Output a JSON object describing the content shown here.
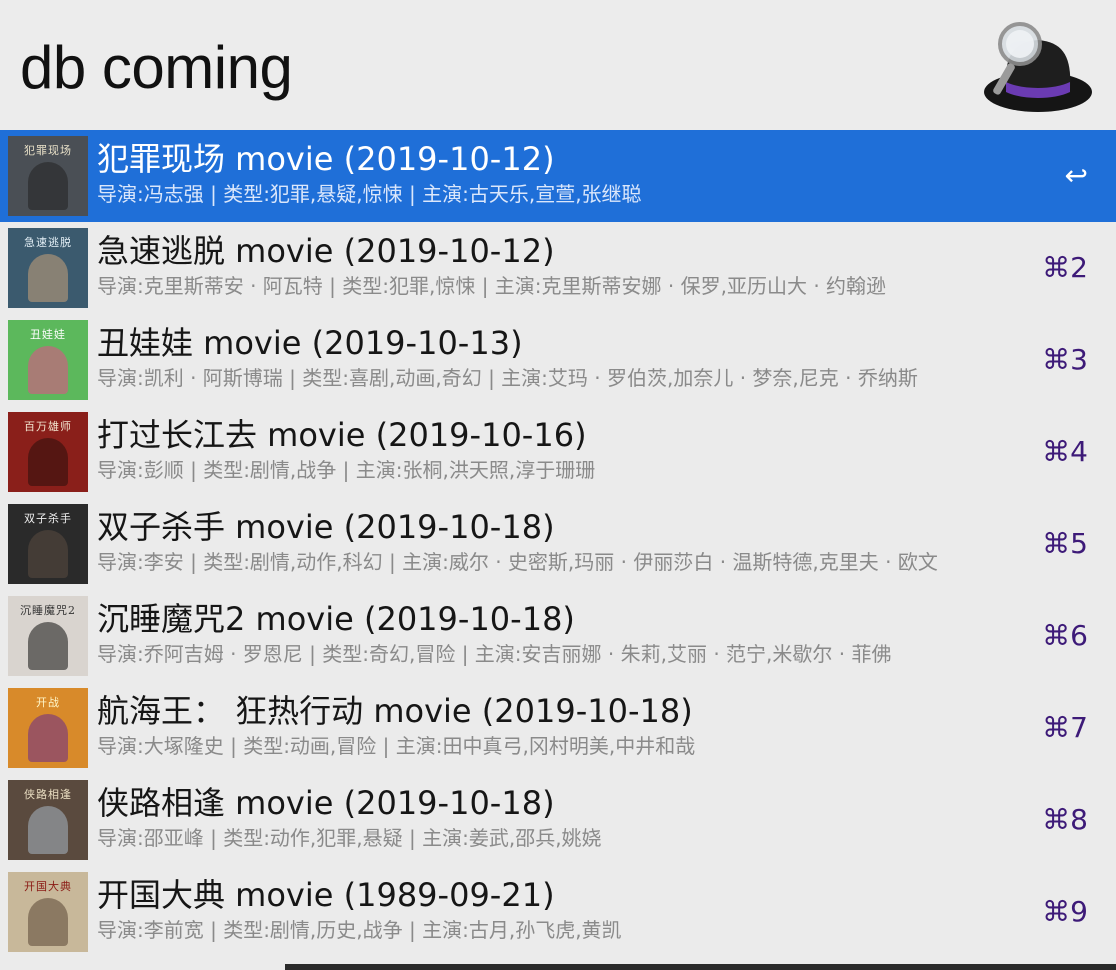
{
  "query": {
    "value": "db coming"
  },
  "results": [
    {
      "title": "犯罪现场 movie (2019-10-12)",
      "subtitle": "导演:冯志强 | 类型:犯罪,悬疑,惊悚 | 主演:古天乐,宣萱,张继聪",
      "shortcut": "↩",
      "selected": true,
      "poster": {
        "text": "犯罪现场",
        "bg": "#4a4f55",
        "fg": "#e8e0c8",
        "fig": "#222"
      }
    },
    {
      "title": "急速逃脱 movie (2019-10-12)",
      "subtitle": "导演:克里斯蒂安 · 阿瓦特 | 类型:犯罪,惊悚 | 主演:克里斯蒂安娜 · 保罗,亚历山大 · 约翰逊",
      "shortcut": "⌘2",
      "selected": false,
      "poster": {
        "text": "急速逃脱",
        "bg": "#3b5a6e",
        "fg": "#e2eef5",
        "fig": "#c9a27a"
      }
    },
    {
      "title": "丑娃娃 movie (2019-10-13)",
      "subtitle": "导演:凯利 · 阿斯博瑞 | 类型:喜剧,动画,奇幻 | 主演:艾玛 · 罗伯茨,加奈儿 · 梦奈,尼克 · 乔纳斯",
      "shortcut": "⌘3",
      "selected": false,
      "poster": {
        "text": "丑娃娃",
        "bg": "#5cb85c",
        "fg": "#ffffff",
        "fig": "#e84a8a"
      }
    },
    {
      "title": "打过长江去 movie (2019-10-16)",
      "subtitle": "导演:彭顺 | 类型:剧情,战争 | 主演:张桐,洪天照,淳于珊珊",
      "shortcut": "⌘4",
      "selected": false,
      "poster": {
        "text": "百万雄师",
        "bg": "#8a1f1a",
        "fg": "#f3e6d0",
        "fig": "#2a0e0c"
      }
    },
    {
      "title": "双子杀手 movie (2019-10-18)",
      "subtitle": "导演:李安 | 类型:剧情,动作,科幻 | 主演:威尔 · 史密斯,玛丽 · 伊丽莎白 · 温斯特德,克里夫 · 欧文",
      "shortcut": "⌘5",
      "selected": false,
      "poster": {
        "text": "双子杀手",
        "bg": "#2a2a2a",
        "fg": "#eeeeee",
        "fig": "#5a4a40"
      }
    },
    {
      "title": "沉睡魔咒2 movie (2019-10-18)",
      "subtitle": "导演:乔阿吉姆 · 罗恩尼 | 类型:奇幻,冒险 | 主演:安吉丽娜 · 朱莉,艾丽 · 范宁,米歇尔 · 菲佛",
      "shortcut": "⌘6",
      "selected": false,
      "poster": {
        "text": "沉睡魔咒2",
        "bg": "#d9d4cf",
        "fg": "#333333",
        "fig": "#111"
      }
    },
    {
      "title": "航海王： 狂热行动 movie (2019-10-18)",
      "subtitle": "导演:大塚隆史 | 类型:动画,冒险 | 主演:田中真弓,冈村明美,中井和哉",
      "shortcut": "⌘7",
      "selected": false,
      "poster": {
        "text": "开战",
        "bg": "#d88a2a",
        "fg": "#fff6c8",
        "fig": "#6a2a8a"
      }
    },
    {
      "title": "侠路相逢 movie (2019-10-18)",
      "subtitle": "导演:邵亚峰 | 类型:动作,犯罪,悬疑 | 主演:姜武,邵兵,姚娆",
      "shortcut": "⌘8",
      "selected": false,
      "poster": {
        "text": "侠路相逢",
        "bg": "#5a4a3e",
        "fg": "#e8dcc0",
        "fig": "#a7b6c2"
      }
    },
    {
      "title": "开国大典 movie (1989-09-21)",
      "subtitle": "导演:李前宽 | 类型:剧情,历史,战争 | 主演:古月,孙飞虎,黄凯",
      "shortcut": "⌘9",
      "selected": false,
      "poster": {
        "text": "开国大典",
        "bg": "#c8b89a",
        "fg": "#8a1a14",
        "fig": "#5a4634"
      }
    }
  ]
}
